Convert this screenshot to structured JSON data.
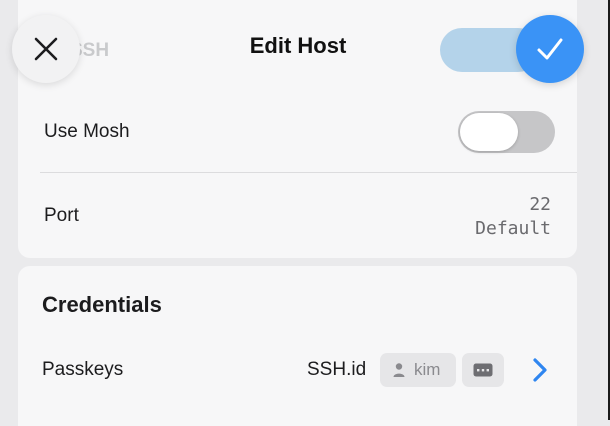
{
  "header": {
    "title": "Edit Host",
    "behind_label": "SSH",
    "close_icon": "close-icon",
    "confirm_icon": "checkmark-icon",
    "accent": "#3a93f6"
  },
  "settings": {
    "use_mosh": {
      "label": "Use Mosh",
      "enabled": false
    },
    "port": {
      "label": "Port",
      "value": "22",
      "hint": "Default"
    }
  },
  "credentials": {
    "section_title": "Credentials",
    "passkeys": {
      "label": "Passkeys",
      "provider": "SSH.id",
      "user": "kim",
      "user_icon": "person-icon",
      "key_icon": "keyboard-icon",
      "chevron_icon": "chevron-right-icon"
    }
  }
}
